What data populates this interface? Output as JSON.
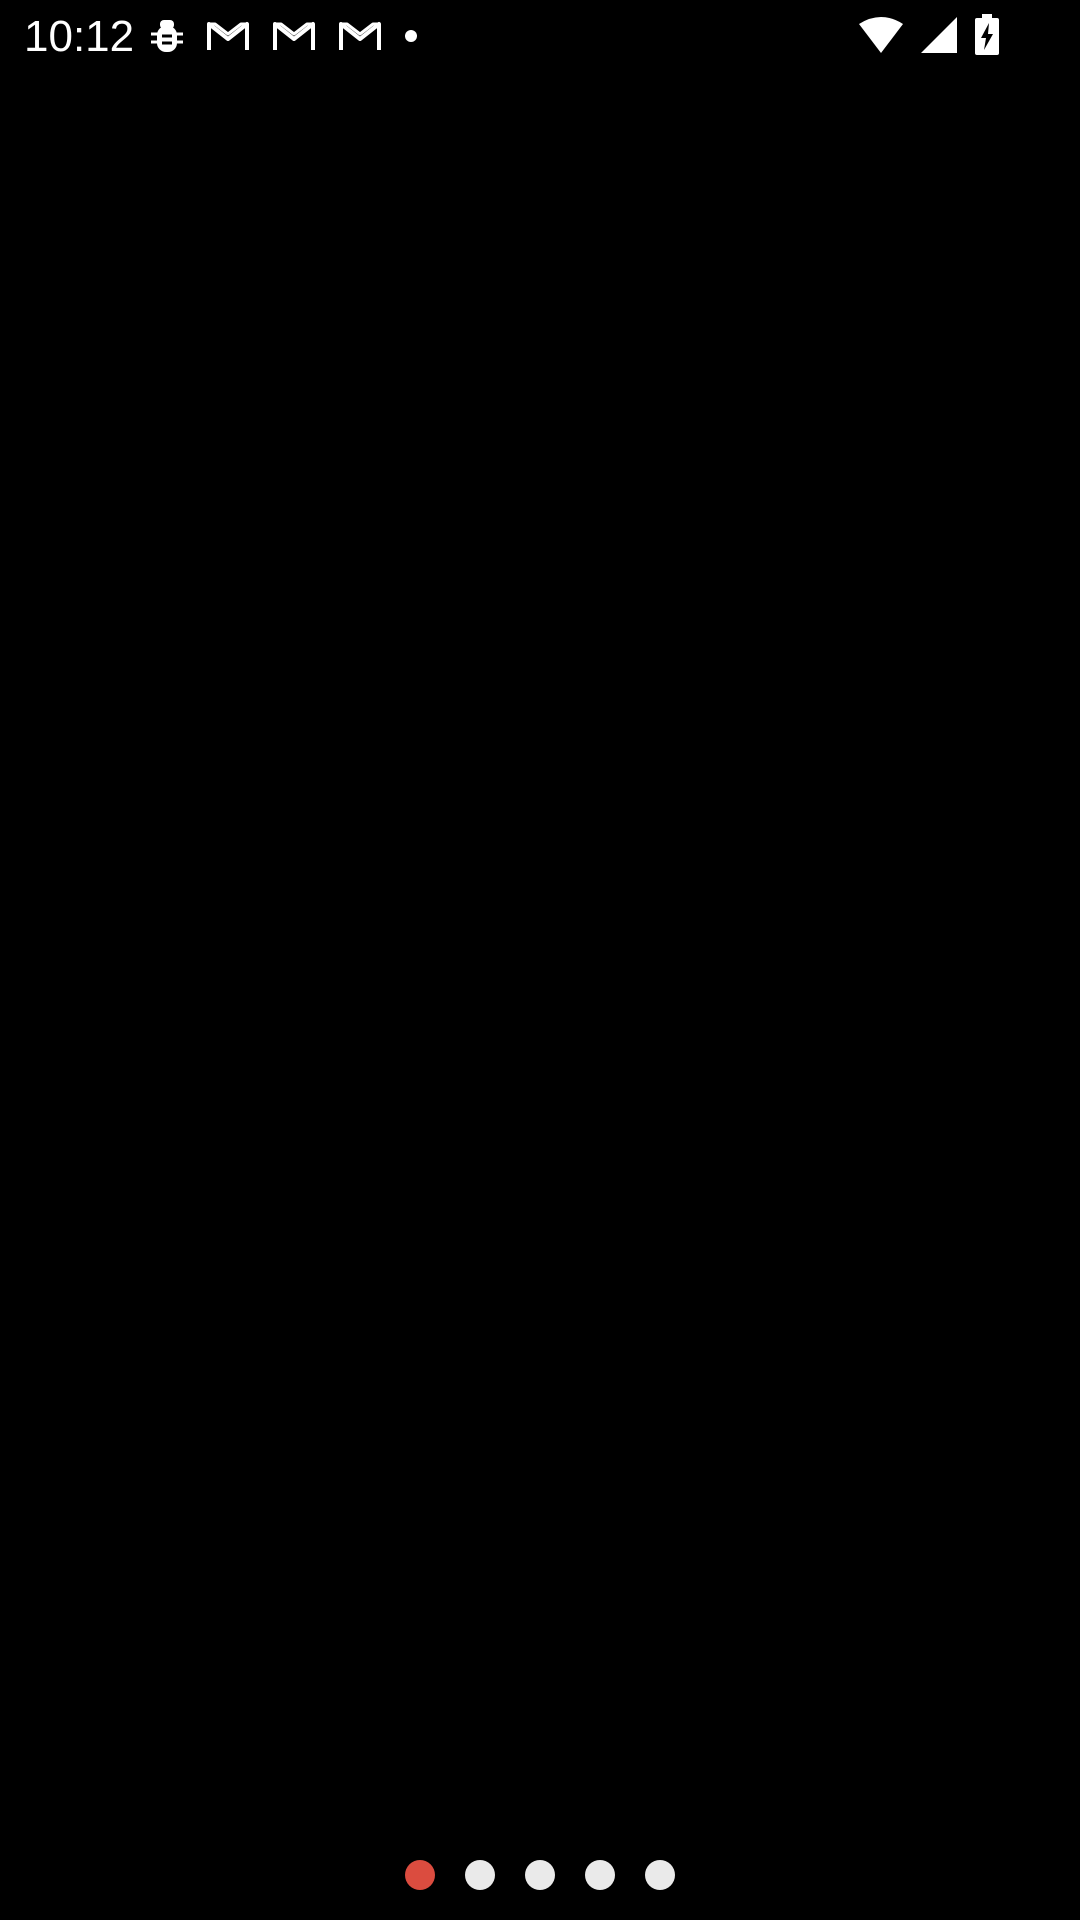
{
  "status_bar": {
    "time": "10:12",
    "left_icons": [
      "bug-icon",
      "gmail-icon",
      "gmail-icon",
      "gmail-icon",
      "notification-dot-icon"
    ],
    "right_icons": [
      "wifi-icon",
      "cellular-signal-icon",
      "battery-charging-icon"
    ]
  },
  "page_indicator": {
    "count": 5,
    "active_index": 0,
    "active_color": "#DB4C3F",
    "inactive_color": "#EAEAEA"
  },
  "colors": {
    "background": "#000000",
    "status_foreground": "#FFFFFF"
  }
}
